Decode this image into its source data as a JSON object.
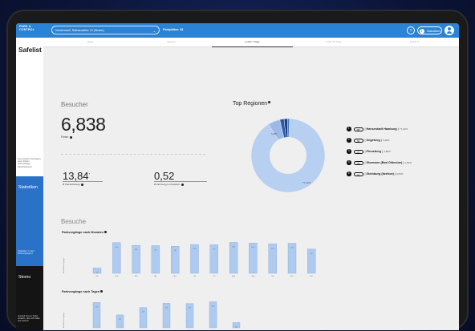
{
  "header": {
    "brand_line1": "PARK &",
    "brand_line2": "CONTROL",
    "location": "Norderstedt, Rathausallee 15 (Strabe)",
    "parking_label": "Parkplätze: 81",
    "help": "?",
    "stats_label": "Statistiken"
  },
  "sidebar": {
    "title": "Safelist",
    "note": "Kennzeichen hinzufügen, wenn Parker Nutzeranlage Abscheidung-in",
    "stats_title": "Statistiken",
    "stats_note": "Statistiken zu den Parkvorgängen?",
    "storno_title": "Storno",
    "storno_note": "Jemand hat ein Ticket erhalten, das nicht hätte sein sollen?"
  },
  "tabs": [
    "Heute",
    "Gestern",
    "Letzte 7 Tage",
    "Letzte 30 Tage",
    "Zeitraum"
  ],
  "active_tab": 2,
  "visitors": {
    "heading": "Besucher",
    "total": "6,838",
    "total_label": "Parker",
    "metric1_value": "13,84",
    "metric1_unit": "*",
    "metric1_label": "Ø Parkzeitbeitrag",
    "metric2_value": "0,52",
    "metric2_label": "Ø Fahrzeug pro Parkplatz"
  },
  "top_regions": {
    "heading": "Top Regionen",
    "items": [
      {
        "rank": "1",
        "plate": "HH",
        "region": "Hansestadt Hamburg",
        "pct": "77,22%"
      },
      {
        "rank": "2",
        "plate": "SE",
        "region": "Segeberg",
        "pct": "5,28%"
      },
      {
        "rank": "3",
        "plate": "PI",
        "region": "Pinneberg",
        "pct": "1,85%"
      },
      {
        "rank": "4",
        "plate": "OD",
        "region": "Stormarn (Bad Oldesloe)",
        "pct": "1,55%"
      },
      {
        "rank": "5",
        "plate": "IZ",
        "region": "Steinburg (Itzehoe)",
        "pct": "0,83%"
      }
    ],
    "donut_inner_label_main": "77,22%",
    "donut_inner_label_small": "5,28%"
  },
  "visits": {
    "heading": "Besuche",
    "monthly_title": "Parkvorgänge nach Monaten",
    "daily_title": "Parkvorgänge nach Tagen",
    "y_label": "Anzahl Parkvorgänge"
  },
  "colors": {
    "topbar": "#2a83d4",
    "bar": "#aecbef",
    "bar_border": "#6a9ad6",
    "donut_main": "#b7cff0",
    "donut_mid": "#9bbbe6",
    "donut_dark": "#2b5aa8",
    "donut_darker": "#1b3f86"
  },
  "chart_data": [
    {
      "type": "bar",
      "title": "Parkvorgänge nach Monaten",
      "categories": [
        "Jan",
        "Feb",
        "Mär",
        "Apr",
        "Mai",
        "Jun",
        "Jul",
        "Aug",
        "Sep",
        "Okt",
        "Nov",
        "Dez"
      ],
      "values": [
        180,
        1050,
        960,
        950,
        930,
        990,
        980,
        1060,
        1040,
        1010,
        1030,
        830
      ],
      "ylabel": "Anzahl Parkvorgänge"
    },
    {
      "type": "bar",
      "title": "Parkvorgänge nach Tagen",
      "categories": [
        "Mo",
        "Di",
        "Mi",
        "Do",
        "Fr",
        "Sa",
        "So"
      ],
      "values": [
        1020,
        520,
        820,
        990,
        980,
        1050,
        210
      ],
      "ylabel": "Anzahl Parkvorgänge"
    },
    {
      "type": "pie",
      "title": "Top Regionen",
      "categories": [
        "Hansestadt Hamburg",
        "Segeberg",
        "Pinneberg",
        "Stormarn (Bad Oldesloe)",
        "Steinburg (Itzehoe)"
      ],
      "values": [
        77.22,
        5.28,
        1.85,
        1.55,
        0.83
      ]
    }
  ]
}
